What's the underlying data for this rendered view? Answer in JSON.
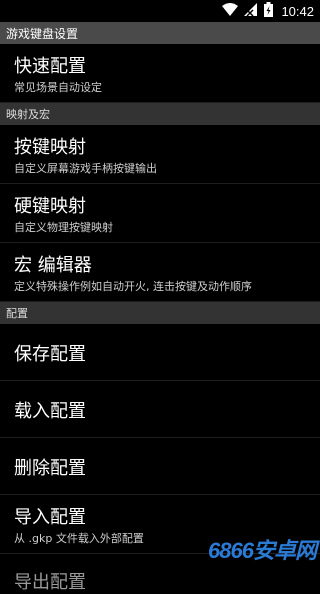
{
  "status_bar": {
    "time": "10:42",
    "icons": [
      "wifi-icon",
      "signal-icon",
      "battery-icon"
    ]
  },
  "title_bar": {
    "title": "游戏键盘设置"
  },
  "sections": {
    "quick": {
      "items": [
        {
          "title": "快速配置",
          "subtitle": "常见场景自动设定"
        }
      ]
    },
    "mapping": {
      "header": "映射及宏",
      "items": [
        {
          "title": "按键映射",
          "subtitle": "自定义屏幕游戏手柄按键输出"
        },
        {
          "title": "硬键映射",
          "subtitle": "自定义物理按键映射"
        },
        {
          "title": "宏 编辑器",
          "subtitle": "定义特殊操作例如自动开火, 连击按键及动作顺序"
        }
      ]
    },
    "config": {
      "header": "配置",
      "items": [
        {
          "title": "保存配置"
        },
        {
          "title": "载入配置"
        },
        {
          "title": "删除配置"
        },
        {
          "title": "导入配置",
          "subtitle": "从 .gkp 文件载入外部配置"
        },
        {
          "title": "导出配置"
        }
      ]
    }
  },
  "watermark": "6866安卓网",
  "colors": {
    "background": "#000000",
    "title_bar": "#4a4a4a",
    "section_header": "#333333",
    "watermark": "#2a7bd6"
  }
}
